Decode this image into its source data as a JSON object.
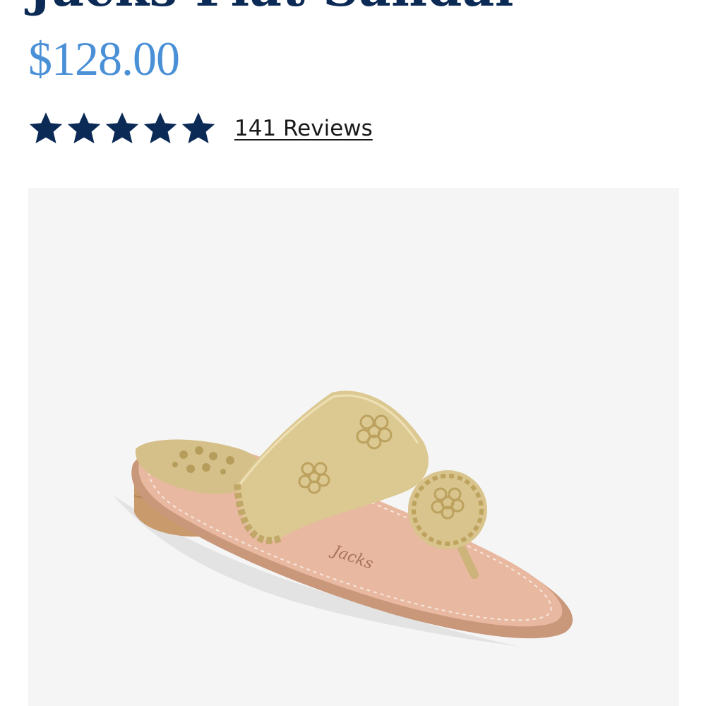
{
  "product": {
    "title": "Jacks Flat Sandal",
    "price": "$128.00",
    "rating": {
      "stars": 5,
      "max_stars": 5,
      "reviews_label": "141 Reviews"
    },
    "image": {
      "icon": "sandal-product-image"
    }
  },
  "colors": {
    "title": "#0b2a55",
    "price": "#4a90d6",
    "star": "#0b2a55",
    "image_background": "#f5f5f5",
    "gold": "#d8c68e",
    "sole": "#e2b196"
  }
}
